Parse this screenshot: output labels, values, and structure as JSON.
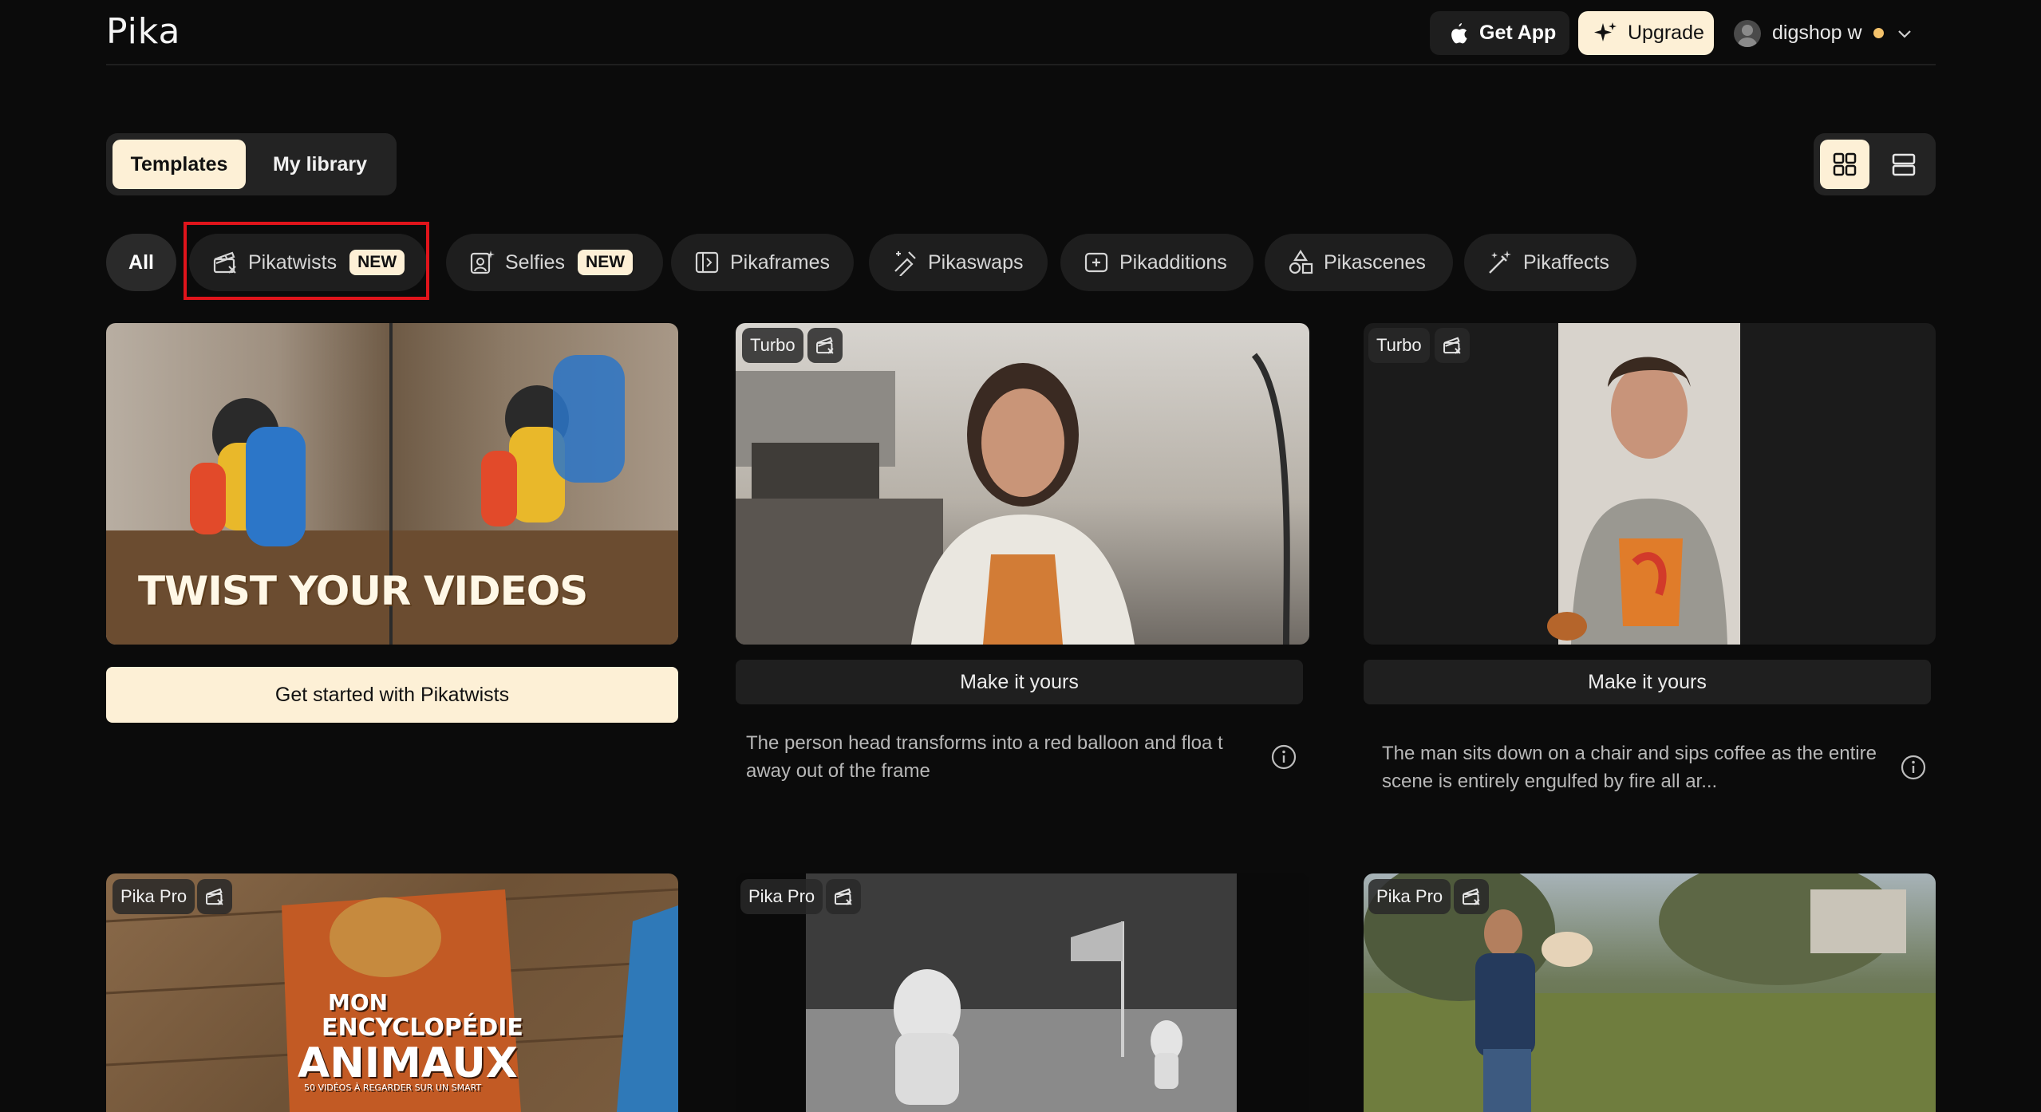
{
  "header": {
    "logo": "Pika",
    "get_app": "Get App",
    "upgrade": "Upgrade",
    "username": "digshop w"
  },
  "tabs": {
    "templates": "Templates",
    "my_library": "My library"
  },
  "filters": [
    {
      "label": "All"
    },
    {
      "label": "Pikatwists",
      "badge": "NEW",
      "icon": "clapperboard-icon"
    },
    {
      "label": "Selfies",
      "badge": "NEW",
      "icon": "selfie-icon"
    },
    {
      "label": "Pikaframes",
      "icon": "frame-icon"
    },
    {
      "label": "Pikaswaps",
      "icon": "swap-icon"
    },
    {
      "label": "Pikadditions",
      "icon": "add-icon"
    },
    {
      "label": "Pikascenes",
      "icon": "shapes-icon"
    },
    {
      "label": "Pikaffects",
      "icon": "magic-wand-icon"
    }
  ],
  "cards": [
    {
      "overlay_text": "TWIST YOUR VIDEOS",
      "cta": "Get started with Pikatwists"
    },
    {
      "tag": "Turbo",
      "cta": "Make it yours",
      "description": "The person head transforms into a red balloon and floa t away out of the frame"
    },
    {
      "tag": "Turbo",
      "cta": "Make it yours",
      "description": "The man sits down on a chair and sips coffee as the entire scene is entirely engulfed by fire all ar..."
    },
    {
      "tag": "Pika Pro",
      "book_line1": "MON",
      "book_line2": "ENCYCLOPÉDIE",
      "book_line3": "ANIMAUX",
      "book_sub": "50 VIDÉOS À REGARDER SUR UN SMART"
    },
    {
      "tag": "Pika Pro"
    },
    {
      "tag": "Pika Pro"
    }
  ],
  "colors": {
    "accent": "#fdf0d6",
    "background": "#0b0b0b",
    "highlight": "#e0141b",
    "status_dot": "#f4c26b"
  }
}
